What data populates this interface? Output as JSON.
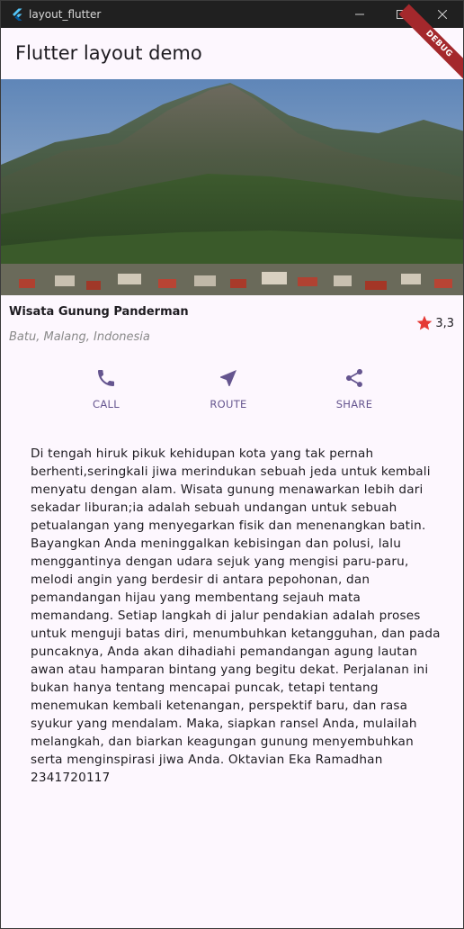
{
  "window": {
    "title": "layout_flutter"
  },
  "appbar": {
    "title": "Flutter layout demo",
    "debug_badge": "DEBUG"
  },
  "place": {
    "name": "Wisata Gunung Panderman",
    "location": "Batu, Malang, Indonesia",
    "rating": "3,3"
  },
  "buttons": [
    {
      "label": "CALL",
      "icon": "phone-icon"
    },
    {
      "label": "ROUTE",
      "icon": "near-me-icon"
    },
    {
      "label": "SHARE",
      "icon": "share-icon"
    }
  ],
  "description": "Di tengah hiruk pikuk kehidupan kota yang tak pernah berhenti,seringkali jiwa merindukan sebuah jeda untuk kembali menyatu dengan alam. Wisata gunung menawarkan lebih dari sekadar liburan;ia adalah sebuah undangan untuk sebuah petualangan yang menyegarkan fisik dan menenangkan batin. Bayangkan Anda meninggalkan kebisingan dan polusi, lalu menggantinya dengan udara sejuk yang mengisi paru-paru, melodi angin yang berdesir di antara pepohonan, dan pemandangan hijau yang membentang sejauh mata memandang. Setiap langkah di jalur pendakian adalah proses untuk menguji batas diri, menumbuhkan ketangguhan, dan pada puncaknya, Anda akan dihadiahi pemandangan agung lautan awan atau hamparan bintang yang begitu dekat. Perjalanan ini bukan hanya tentang mencapai puncak, tetapi tentang menemukan kembali ketenangan, perspektif baru, dan rasa syukur yang mendalam. Maka, siapkan ransel Anda, mulailah melangkah, dan biarkan keagungan gunung menyembuhkan serta menginspirasi jiwa Anda. Oktavian Eka Ramadhan 2341720117",
  "colors": {
    "accent": "#65558f",
    "star": "#e53935",
    "background": "#fdf7fe",
    "titlebar": "#202020"
  }
}
